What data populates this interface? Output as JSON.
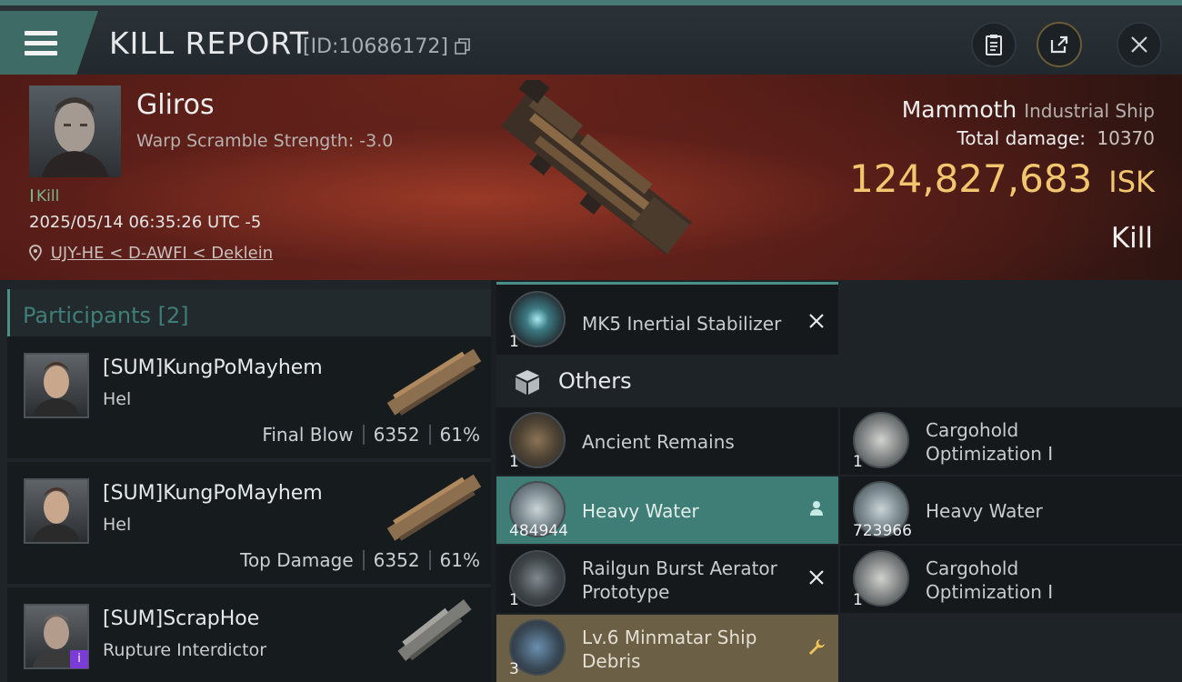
{
  "titlebar": {
    "title": "KILL REPORT",
    "id_text": "[ID:10686172]"
  },
  "victim": {
    "name": "Gliros",
    "subtitle": "Warp Scramble Strength: -3.0",
    "tag": "Kill",
    "datetime": "2025/05/14 06:35:26 UTC -5",
    "location": "UJY-HE < D-AWFI < Deklein"
  },
  "summary": {
    "ship_name": "Mammoth",
    "ship_class": "Industrial Ship",
    "total_damage_label": "Total damage:",
    "total_damage_value": "10370",
    "isk_value": "124,827,683",
    "isk_unit": "ISK",
    "outcome": "Kill"
  },
  "participants": {
    "label": "Participants",
    "count": "[2]",
    "rows": [
      {
        "name": "[SUM]KungPoMayhem",
        "ship": "Hel",
        "role": "Final Blow",
        "damage": "6352",
        "percent": "61%"
      },
      {
        "name": "[SUM]KungPoMayhem",
        "ship": "Hel",
        "role": "Top Damage",
        "damage": "6352",
        "percent": "61%"
      },
      {
        "name": "[SUM]ScrapHoe",
        "ship": "Rupture Interdictor",
        "badge": "i"
      }
    ]
  },
  "items": {
    "top": {
      "name": "MK5 Inertial Stabilizer",
      "qty": "1"
    },
    "others_label": "Others",
    "list": [
      {
        "name": "Ancient Remains",
        "qty": "1"
      },
      {
        "name": "Cargohold Optimization I",
        "qty": "1"
      },
      {
        "name": "Heavy Water",
        "qty": "484944"
      },
      {
        "name": "Heavy Water",
        "qty": "723966"
      },
      {
        "name": "Railgun Burst Aerator Prototype",
        "qty": "1"
      },
      {
        "name": "Cargohold Optimization I",
        "qty": "1"
      },
      {
        "name": "Lv.6 Minmatar Ship Debris",
        "qty": "3"
      }
    ]
  },
  "colors": {
    "accent_teal": "#3f7e77",
    "isk_gold": "#f2c66e",
    "banner_red": "#7a2a1e"
  }
}
